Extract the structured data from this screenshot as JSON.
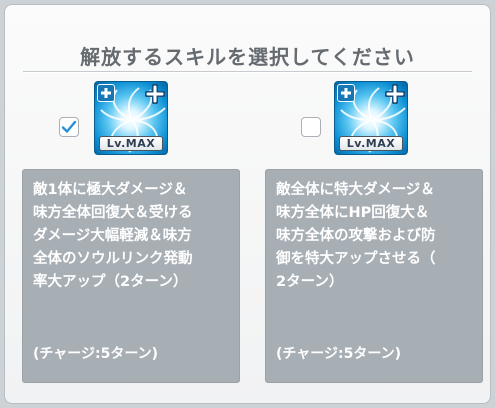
{
  "dialog": {
    "title": "解放するスキルを選択してください"
  },
  "options": [
    {
      "checked": true,
      "icon": "water-swirl-icon",
      "level_badge": "Lv.MAX",
      "description": "敵1体に極大ダメージ＆\n味方全体回復大＆受ける\nダメージ大幅軽減＆味方\n全体のソウルリンク発動\n率大アップ（2ターン）",
      "charge": "(チャージ:5ターン)"
    },
    {
      "checked": false,
      "icon": "water-swirl-icon",
      "level_badge": "Lv.MAX",
      "description": "敵全体に特大ダメージ＆\n味方全体にHP回復大＆\n味方全体の攻撃および防\n御を特大アップさせる（\n2ターン）",
      "charge": "(チャージ:5ターン)"
    }
  ],
  "colors": {
    "checkbox_check": "#2a8fd6",
    "description_bg": "#a7aeb4",
    "title_text": "#666b70"
  }
}
